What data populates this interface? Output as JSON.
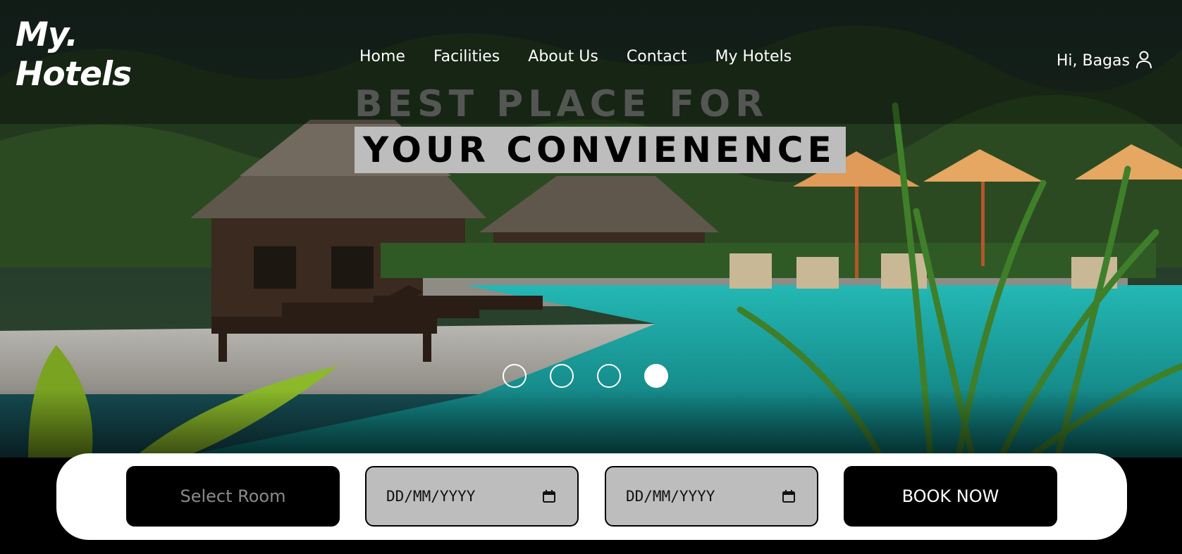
{
  "brand": {
    "line1": "My.",
    "line2": "Hotels"
  },
  "nav": {
    "items": [
      "Home",
      "Facilities",
      "About Us",
      "Contact",
      "My Hotels"
    ]
  },
  "user": {
    "greeting": "Hi, Bagas",
    "icon": "user-icon"
  },
  "hero": {
    "headline_line1": "BEST PLACE FOR",
    "headline_line2": "YOUR CONVIENENCE",
    "slides_total": 4,
    "active_slide": 4
  },
  "booking": {
    "room_select": "Select Room",
    "checkin_placeholder": "DD/MM/YYYY",
    "checkout_placeholder": "DD/MM/YYYY",
    "book_label": "BOOK NOW",
    "calendar_icon": "calendar-icon"
  },
  "colors": {
    "accent": "#000000",
    "field_bg": "#bdbdbd",
    "pool": "#1fb3b0",
    "text_light": "#ffffff"
  }
}
